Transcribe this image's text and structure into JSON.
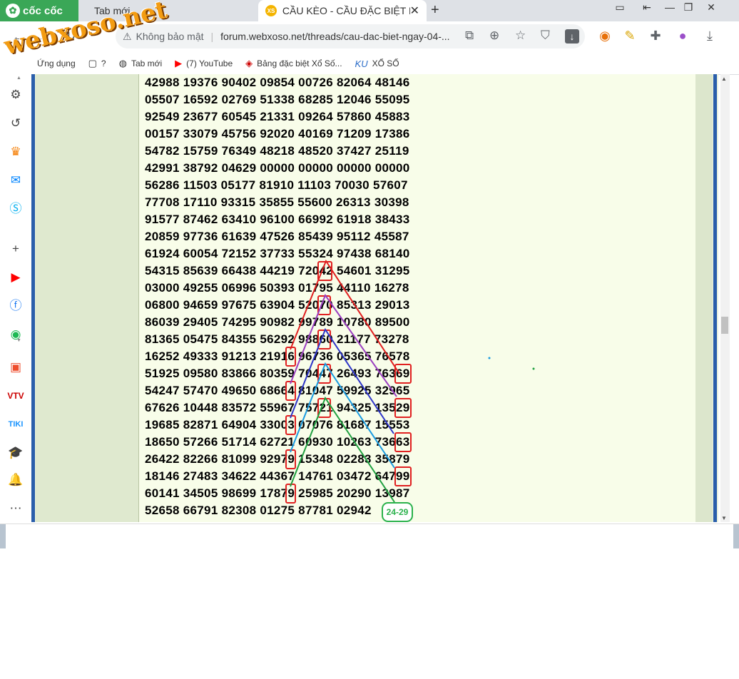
{
  "browser": {
    "brand": "cốc cốc",
    "tabs": [
      {
        "title": "Tab mới"
      },
      {
        "title": "CẦU KÈO - CẦU ĐẶC BIỆT NG",
        "favicon": "XS"
      }
    ],
    "new_tab": "+",
    "window_controls": [
      "▭",
      "⇤",
      "—",
      "❐",
      "✕"
    ]
  },
  "toolbar": {
    "back": "←",
    "forward": "→",
    "security_label": "Không bảo mật",
    "url": "forum.webxoso.net/threads/cau-dac-biet-ngay-04-..."
  },
  "bookmarks": [
    {
      "label": "Ứng dụng",
      "icon": "apps-icon"
    },
    {
      "label": "?",
      "icon": "folder-icon"
    },
    {
      "label": "Tab mới",
      "icon": "globe-icon"
    },
    {
      "label": "(7) YouTube",
      "icon": "youtube-icon"
    },
    {
      "label": "Bảng đặc biệt Xổ Số...",
      "icon": "site-icon"
    },
    {
      "label": "XỔ SỐ",
      "icon": "ku-icon"
    }
  ],
  "watermark": "webxoso.net",
  "numbers": [
    "42988 19376 90402 09854 00726 82064 48146",
    "05507 16592 02769 51338 68285 12046 55095",
    "92549 23677 60545 21331 09264 57860 45883",
    "00157 33079 45756 92020 40169 71209 17386",
    "54782 15759 76349 48218 48520 37427 25119",
    "42991 38792 04629 00000 00000 00000 00000",
    "56286 11503 05177 81910 11103 70030 57607",
    "77708 17110 93315 35855 55600 26313 30398",
    "91577 87462 63410 96100 66992 61918 38433",
    "20859 97736 61639 47526 85439 95112 45587",
    "61924 60054 72152 37733 55324 97438 68140",
    "54315 85639 66438 44219 72042 54601 31295",
    "03000 49255 06996 50393 01795 44110 16278",
    "06800 94659 97675 63904 52070 85313 29013",
    "86039 29405 74295 90982 99789 10780 89500",
    "81365 05475 84355 56292 98860 21177 73278",
    "16252 49333 91213 21916 96736 05365 76578",
    "51925 09580 83866 80359 70447 26493 76369",
    "54247 57470 49650 68664 81047 59925 32965",
    "67626 10448 83572 55967 75721 94325 13529",
    "19685 82871 64904 33003 07076 81687 15553",
    "18650 57266 51714 62721 60930 10263 73663",
    "26422 82266 81099 92979 15348 02283 35879",
    "18146 27483 34622 44367 14761 03472 64799",
    "60141 34505 98699 17879 25985 20290 13987",
    "52658 66791 82308 01275 87781 02942"
  ],
  "result_badge": "24-29",
  "colors": {
    "line_red": "#e02020",
    "line_purple": "#9b3fc0",
    "line_blue": "#2e35c8",
    "line_cyan": "#1a9be0",
    "line_green": "#20a040"
  }
}
